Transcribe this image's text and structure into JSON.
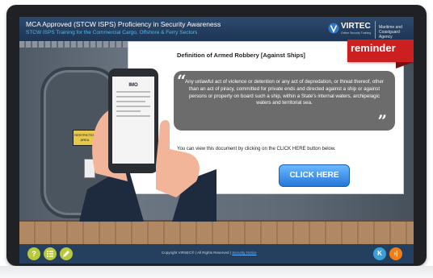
{
  "header": {
    "title": "MCA Approved (STCW ISPS) Proficiency in Security Awareness",
    "subtitle": "STCW ISPS Training for the Commercial Cargo, Offshore & Ferry Sectors",
    "brand": "VIRTEC",
    "brand_tagline": "Online Security Training",
    "agency_line1": "Maritime and",
    "agency_line2": "Coastguard Agency"
  },
  "reminder": {
    "label": "reminder"
  },
  "scene": {
    "door_sign": "RESTRICTED AREA"
  },
  "content": {
    "heading": "Definition of Armed Robbery [Against Ships]",
    "quote": "Any unlawful act of violence or detention or any act of depredation, or threat thereof, other than an act of piracy, committed for private ends and directed against a ship or against persons or property on board such a ship, within a State's internal waters, archipelagic waters and territorial sea.",
    "instruction": "You can view this document by clicking on the CLICK HERE button below.",
    "button": "CLICK HERE"
  },
  "phone": {
    "brand": "IMO"
  },
  "footer": {
    "help": "?",
    "copyright": "Copyright VIRSEC® | All Rights Reserved | ",
    "security_link": "Security Notice",
    "prev": "K",
    "next": "›|"
  },
  "colors": {
    "header_bg": "#1e3554",
    "accent_blue": "#4fb7e8",
    "reminder_red": "#cc1f1f",
    "button_blue": "#2677d9",
    "nav_prev": "#3aa1d8",
    "nav_next": "#f07e16",
    "help_green": "#b9c93e"
  }
}
